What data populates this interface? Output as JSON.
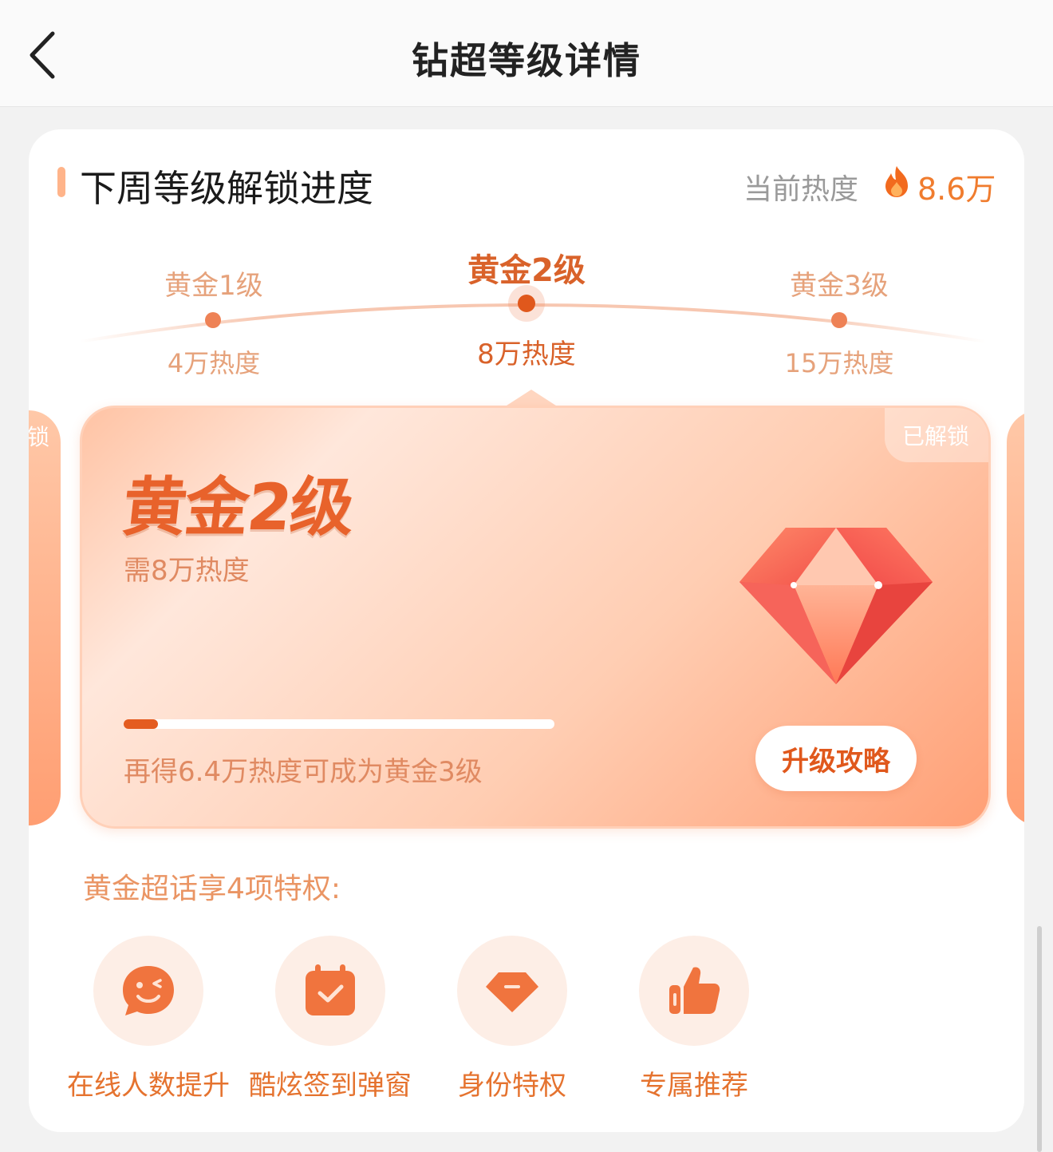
{
  "nav": {
    "title": "钻超等级详情"
  },
  "section": {
    "title": "下周等级解锁进度",
    "current_heat_label": "当前热度",
    "current_heat_value": "8.6万"
  },
  "timeline": {
    "levels": [
      {
        "name": "黄金1级",
        "heat": "4万热度",
        "active": false
      },
      {
        "name": "黄金2级",
        "heat": "8万热度",
        "active": true
      },
      {
        "name": "黄金3级",
        "heat": "15万热度",
        "active": false
      }
    ]
  },
  "level_card": {
    "prev_card_partial_text": "锁",
    "badge": "已解锁",
    "level_name": "黄金2级",
    "requirement": "需8万热度",
    "progress_fraction": 0.08,
    "progress_text": "再得6.4万热度可成为黄金3级",
    "strategy_button": "升级攻略"
  },
  "privileges": {
    "title": "黄金超话享4项特权:",
    "items": [
      {
        "label": "在线人数提升",
        "icon": "smiley-chat-icon"
      },
      {
        "label": "酷炫签到弹窗",
        "icon": "calendar-check-icon"
      },
      {
        "label": "身份特权",
        "icon": "gem-badge-icon"
      },
      {
        "label": "专属推荐",
        "icon": "thumbs-up-icon"
      }
    ]
  },
  "colors": {
    "accent": "#e0581c",
    "accent_light": "#ee8256",
    "card_gradient_start": "#ffc3a4",
    "card_gradient_end": "#ff9f75",
    "privilege_circle": "#fdeee6"
  }
}
